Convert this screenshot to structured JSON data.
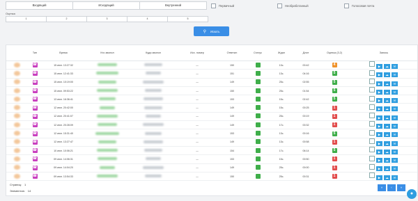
{
  "filters": {
    "direction_tabs": [
      "Входящий",
      "Исходящий",
      "Внутренний"
    ],
    "checkboxes": [
      "Первичный",
      "Необработанный",
      "Голосовая почта"
    ],
    "rating_label": "Оценка",
    "rating_options": [
      "1",
      "2",
      "3",
      "4",
      "5"
    ],
    "search_label": "Искать",
    "search_icon": "magnifier-icon"
  },
  "table": {
    "headers": [
      "",
      "Тип",
      "Время",
      "Кто звонил",
      "Куда звонил",
      "Исх. номер",
      "Ответил",
      "Статус",
      "Ждал",
      "Длит",
      "Оценка (3.2)",
      "Запись"
    ],
    "rows": [
      {
        "time": "15 июн. 13:27:32",
        "out": "—",
        "answered": "150",
        "wait": "13с.",
        "dur": "00:42",
        "rating": "4"
      },
      {
        "time": "15 июн. 12:41:33",
        "out": "—",
        "answered": "151",
        "wait": "13с.",
        "dur": "04:16",
        "rating": "5"
      },
      {
        "time": "15 июн. 10:19:00",
        "out": "—",
        "answered": "149",
        "wait": "25с.",
        "dur": "02:55",
        "rating": "5"
      },
      {
        "time": "15 июн. 09:53:22",
        "out": "—",
        "answered": "150",
        "wait": "25с.",
        "dur": "01:54",
        "rating": "5"
      },
      {
        "time": "13 июн. 16:36:41",
        "out": "—",
        "answered": "153",
        "wait": "15с.",
        "dur": "02:42",
        "rating": "5"
      },
      {
        "time": "12 июн. 20:42:00",
        "out": "—",
        "answered": "149",
        "wait": "15с.",
        "dur": "00:25",
        "rating": "1"
      },
      {
        "time": "12 июн. 20:41:07",
        "out": "—",
        "answered": "149",
        "wait": "25с.",
        "dur": "00:19",
        "rating": "1"
      },
      {
        "time": "12 июн. 20:28:09",
        "out": "—",
        "answered": "149",
        "wait": "17с.",
        "dur": "00:32",
        "rating": "1"
      },
      {
        "time": "12 июн. 15:31:40",
        "out": "—",
        "answered": "153",
        "wait": "13с.",
        "dur": "00:16",
        "rating": "5"
      },
      {
        "time": "12 июн. 13:27:47",
        "out": "—",
        "answered": "149",
        "wait": "13с.",
        "dur": "00:58",
        "rating": "1"
      },
      {
        "time": "10 июн. 10:06:21",
        "out": "—",
        "answered": "154",
        "wait": "17с.",
        "dur": "06:14",
        "rating": "5"
      },
      {
        "time": "09 июн. 14:06:31",
        "out": "—",
        "answered": "153",
        "wait": "15с.",
        "dur": "00:50",
        "rating": "1"
      },
      {
        "time": "09 июн. 14:04:20",
        "out": "—",
        "answered": "149",
        "wait": "25с.",
        "dur": "00:00",
        "rating": "1"
      },
      {
        "time": "09 июн. 13:54:33",
        "out": "—",
        "answered": "150",
        "wait": "25с.",
        "dur": "00:31",
        "rating": "1"
      }
    ]
  },
  "footer": {
    "pages_label": "Страниц:",
    "pages_value": "1",
    "items_label": "Элементов:",
    "items_value": "14"
  },
  "pager": [
    "«",
    "‹",
    "»"
  ],
  "colors": {
    "accent": "#3a8ee6",
    "type": "#c93fbf",
    "ok": "#3fae4a",
    "warn": "#f0932b",
    "bad": "#e24c4c"
  }
}
